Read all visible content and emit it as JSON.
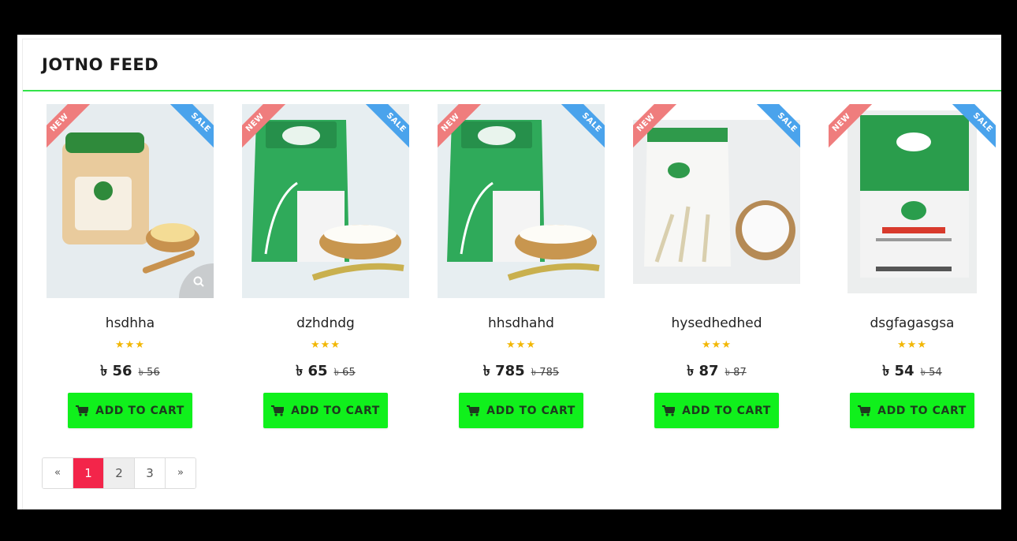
{
  "section": {
    "title": "JOTNO FEED"
  },
  "badges": {
    "new": "NEW",
    "sale": "SALE"
  },
  "colors": {
    "accent": "#33e34a",
    "button": "#10f01c",
    "active_page": "#f3254a",
    "star": "#f2b705",
    "new_ribbon": "#ef7d7d",
    "sale_ribbon": "#4aa3ec"
  },
  "products": [
    {
      "name": "hsdhha",
      "stars": "★★★",
      "price": "৳ 56",
      "old_price": "৳ 56",
      "image": "ghee-jar-image",
      "button": "ADD TO CART"
    },
    {
      "name": "dzhdndg",
      "stars": "★★★",
      "price": "৳ 65",
      "old_price": "৳ 65",
      "image": "rice-bag-image",
      "button": "ADD TO CART"
    },
    {
      "name": "hhsdhahd",
      "stars": "★★★",
      "price": "৳ 785",
      "old_price": "৳ 785",
      "image": "rice-bag-image",
      "button": "ADD TO CART"
    },
    {
      "name": "hysedhedhed",
      "stars": "★★★",
      "price": "৳ 87",
      "old_price": "৳ 87",
      "image": "flour-bag-image",
      "button": "ADD TO CART"
    },
    {
      "name": "dsgfagasgsa",
      "stars": "★★★",
      "price": "৳ 54",
      "old_price": "৳ 54",
      "image": "milk-powder-bag-image",
      "button": "ADD TO CART"
    }
  ],
  "pagination": {
    "prev": "«",
    "pages": [
      "1",
      "2",
      "3"
    ],
    "current": "1",
    "next": "»"
  }
}
